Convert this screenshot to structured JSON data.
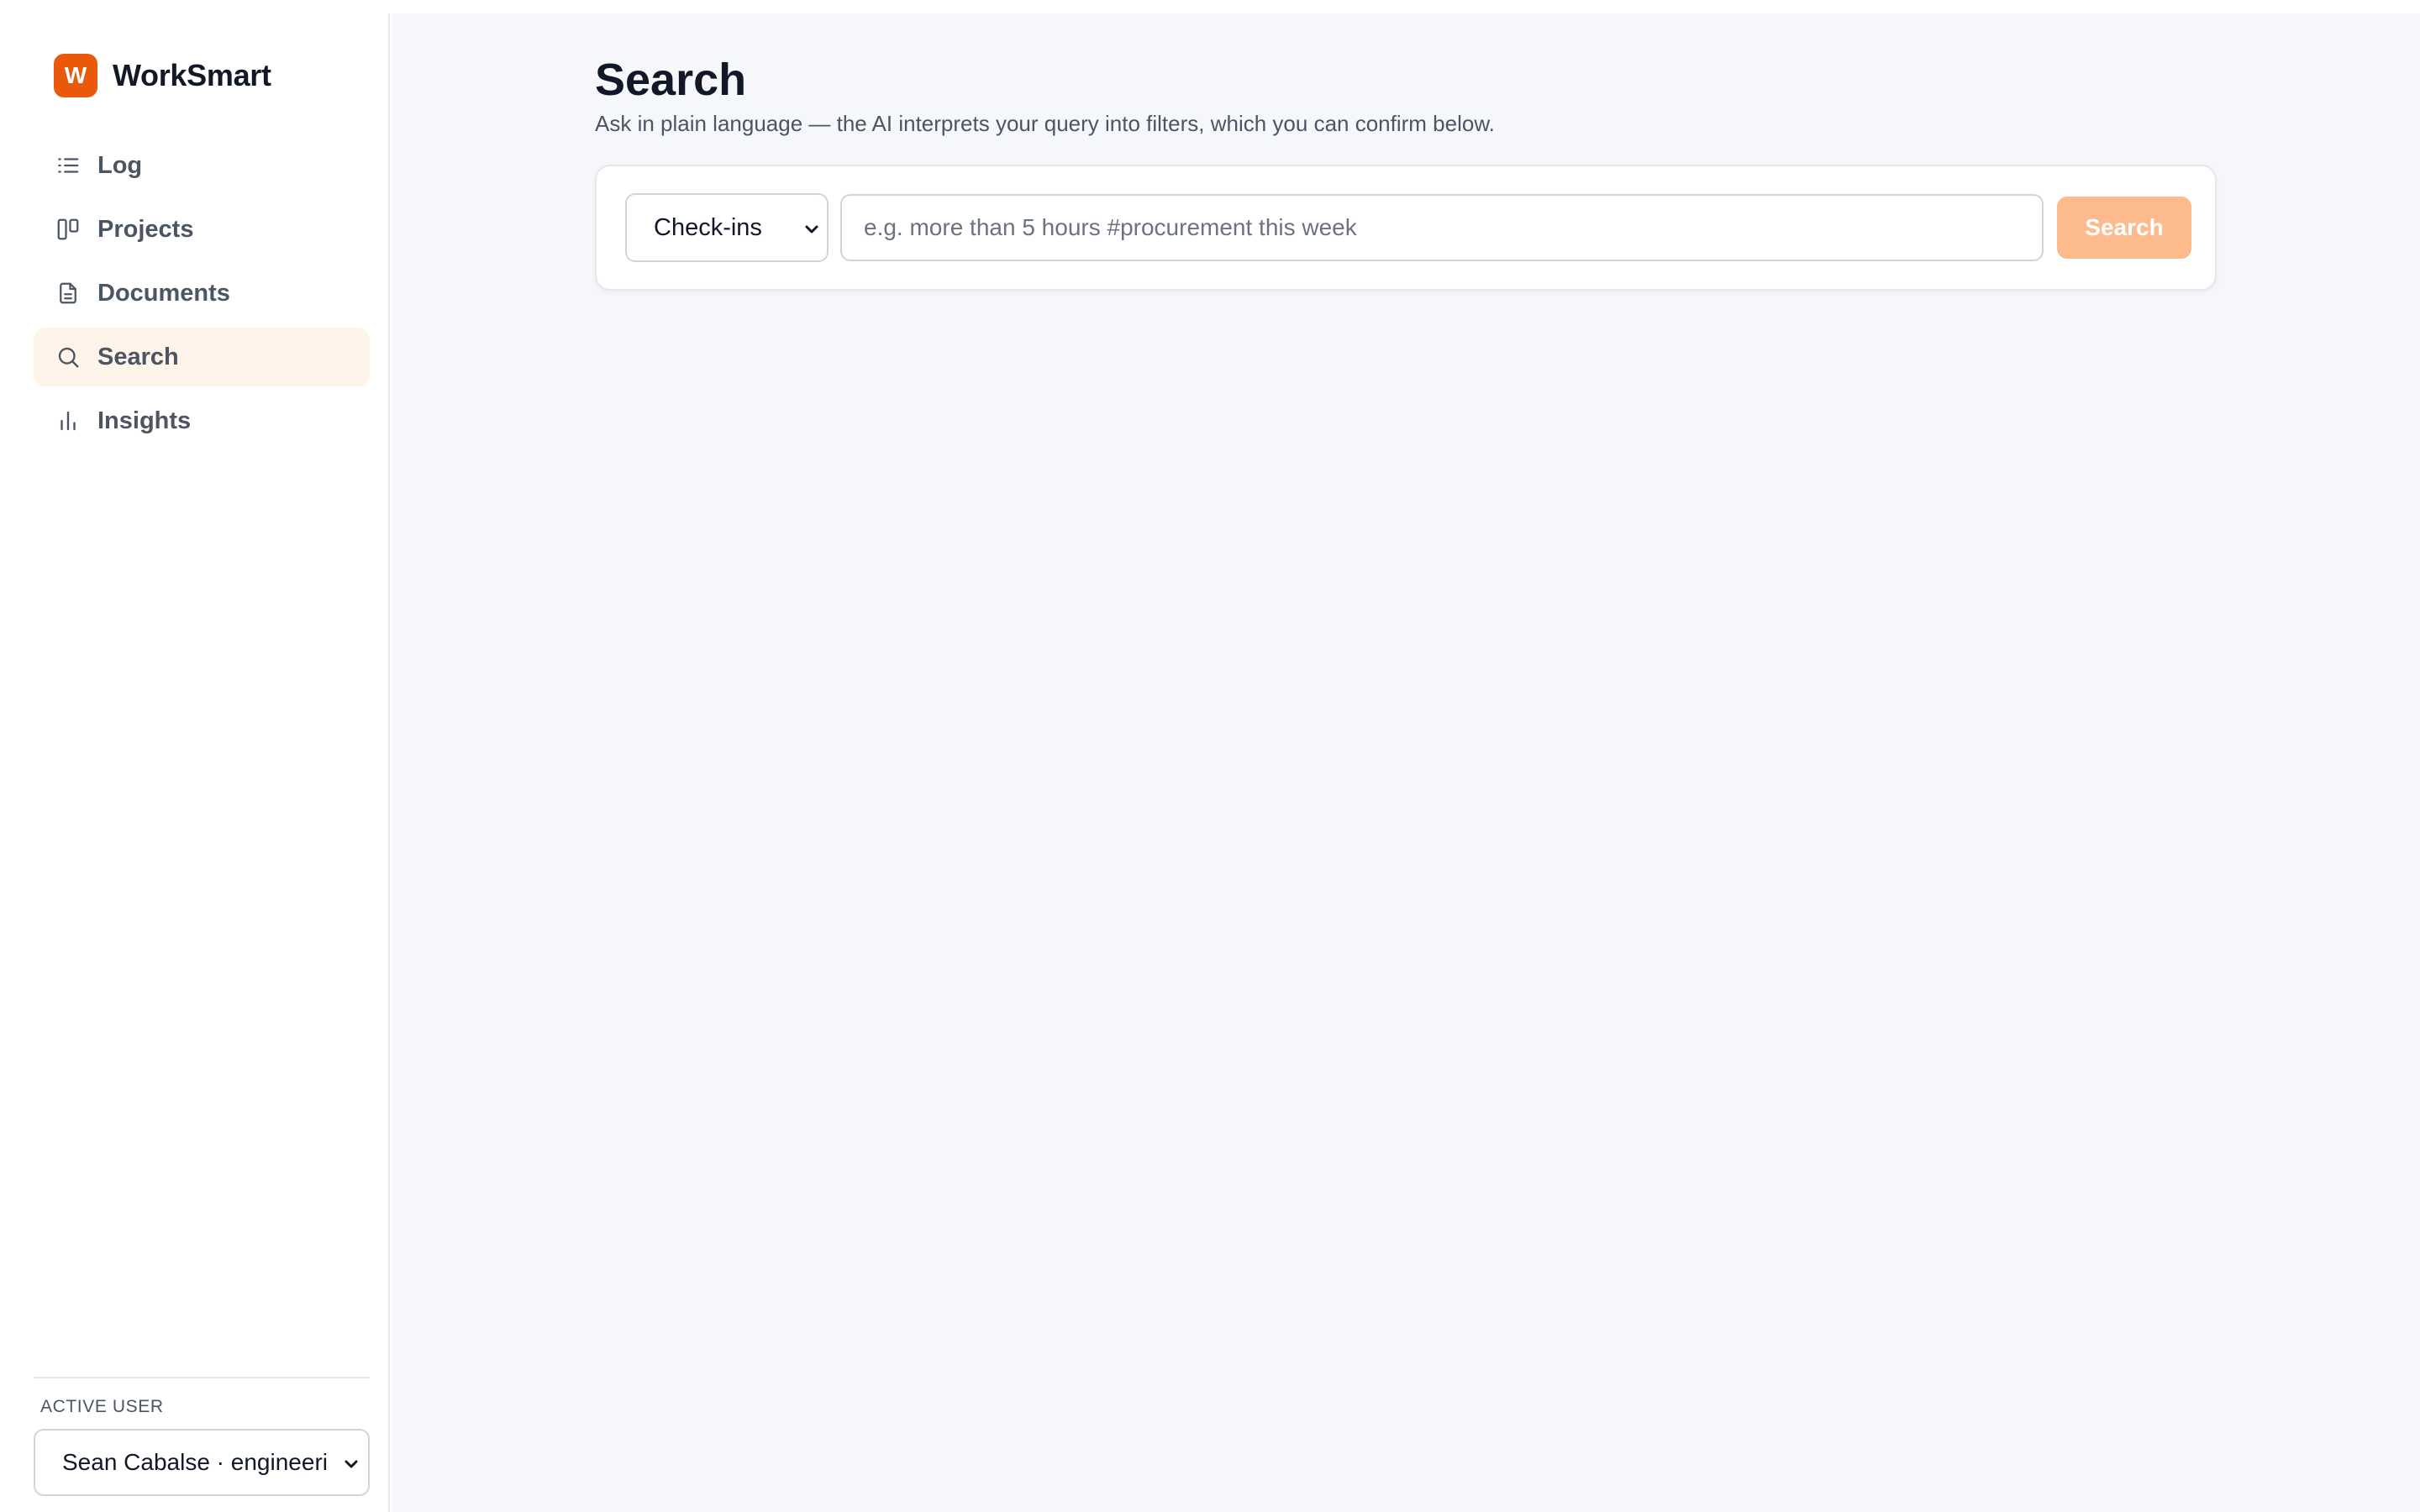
{
  "app": {
    "logo_letter": "W",
    "name": "WorkSmart",
    "accent_color": "#ea580c"
  },
  "sidebar": {
    "items": [
      {
        "label": "Log",
        "icon": "list-icon",
        "active": false
      },
      {
        "label": "Projects",
        "icon": "kanban-icon",
        "active": false
      },
      {
        "label": "Documents",
        "icon": "document-icon",
        "active": false
      },
      {
        "label": "Search",
        "icon": "search-icon",
        "active": true
      },
      {
        "label": "Insights",
        "icon": "bar-chart-icon",
        "active": false
      }
    ],
    "active_user_label": "ACTIVE USER",
    "active_user_value": "Sean Cabalse · engineerin"
  },
  "main": {
    "title": "Search",
    "subtitle": "Ask in plain language — the AI interprets your query into filters, which you can confirm below.",
    "search": {
      "type_selected": "Check-ins",
      "query_value": "",
      "query_placeholder": "e.g. more than 5 hours #procurement this week",
      "button_label": "Search",
      "button_color": "#fdba8c"
    }
  }
}
